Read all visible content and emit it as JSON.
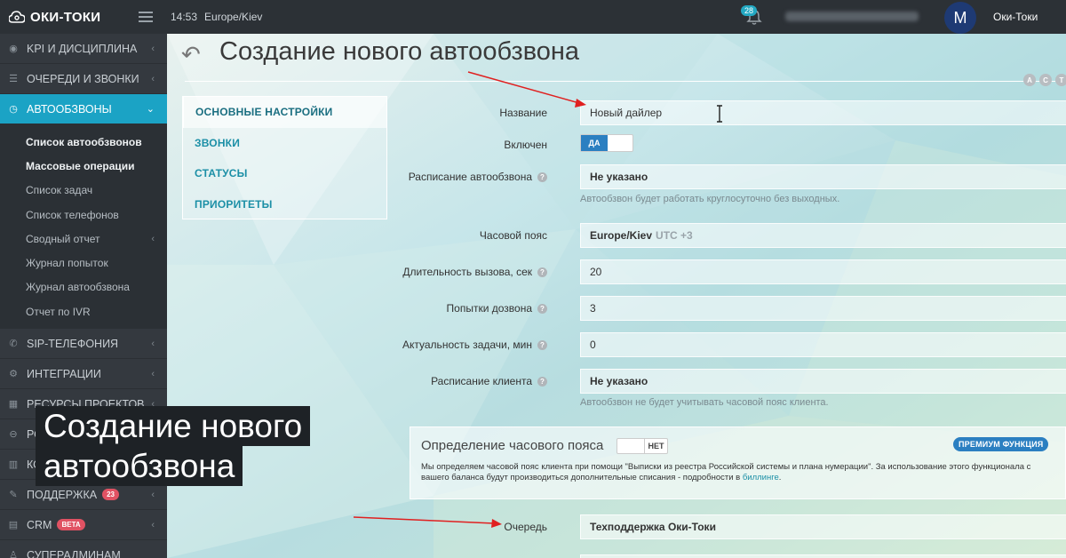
{
  "topbar": {
    "logo": "ОКИ-ТОКИ",
    "time": "14:53",
    "timezone": "Europe/Kiev",
    "notifications": "28",
    "avatar_letter": "M",
    "username": "Оки-Токи"
  },
  "sidebar": {
    "items": [
      {
        "label": "KPI И ДИСЦИПЛИНА",
        "icon": "gauge-icon"
      },
      {
        "label": "ОЧЕРЕДИ И ЗВОНКИ",
        "icon": "list-icon"
      },
      {
        "label": "АВТООБЗВОНЫ",
        "icon": "clock-icon"
      }
    ],
    "sub_items": [
      "Список автообзвонов",
      "Массовые операции",
      "Список задач",
      "Список телефонов",
      "Сводный отчет",
      "Журнал попыток",
      "Журнал автообзвона",
      "Отчет по IVR"
    ],
    "items_after": [
      {
        "label": "SIP-ТЕЛЕФОНИЯ",
        "icon": "phone-icon"
      },
      {
        "label": "ИНТЕГРАЦИИ",
        "icon": "gears-icon"
      },
      {
        "label": "РЕСУРСЫ ПРОЕКТОВ",
        "icon": "grid-icon"
      },
      {
        "label": "РО",
        "icon": "toggle-icon"
      },
      {
        "label": "КО",
        "icon": "bars-icon"
      },
      {
        "label": "ПОДДЕРЖКА",
        "icon": "wrench-icon",
        "badge": "23"
      },
      {
        "label": "CRM",
        "icon": "crm-icon",
        "badge": "BETA"
      },
      {
        "label": "СУПЕРАДМИНАМ",
        "icon": "user-icon"
      }
    ]
  },
  "main": {
    "title": "Создание нового автообзвона",
    "act_buttons": [
      "A",
      "C",
      "T"
    ],
    "tabs": [
      "ОСНОВНЫЕ НАСТРОЙКИ",
      "ЗВОНКИ",
      "СТАТУСЫ",
      "ПРИОРИТЕТЫ"
    ],
    "form": {
      "name_label": "Название",
      "name_value": "Новый дайлер",
      "enabled_label": "Включен",
      "enabled_value": "ДА",
      "schedule_label": "Расписание автообзвона",
      "schedule_value": "Не указано",
      "schedule_hint": "Автообзвон будет работать круглосуточно без выходных.",
      "tz_label": "Часовой пояс",
      "tz_value": "Europe/Kiev",
      "tz_offset": "UTC +3",
      "duration_label": "Длительность вызова, сек",
      "duration_value": "20",
      "attempts_label": "Попытки дозвона",
      "attempts_value": "3",
      "actuality_label": "Актуальность задачи, мин",
      "actuality_value": "0",
      "client_schedule_label": "Расписание клиента",
      "client_schedule_value": "Не указано",
      "client_schedule_hint": "Автообзвон не будет учитывать часовой пояс клиента.",
      "queue_label": "Очередь",
      "queue_value": "Техподдержка Оки-Токи"
    },
    "tz_detect": {
      "title": "Определение часового пояса",
      "toggle": "НЕТ",
      "premium": "ПРЕМИУМ ФУНКЦИЯ",
      "desc": "Мы определяем часовой пояс клиента при помощи \"Выписки из реестра Российской системы и плана нумерации\". За использование этого функционала с вашего баланса будут производиться дополнительные списания - подробности в ",
      "link": "биллинге",
      "desc_end": "."
    }
  },
  "caption": {
    "line1": "Создание нового",
    "line2": "автообзвона"
  },
  "colors": {
    "accent": "#1ba3c5",
    "sidebar_bg": "#34393f",
    "topbar_bg": "#2c3136",
    "toggle_on": "#2b7fc1",
    "annotation_arrow": "#e02020"
  }
}
